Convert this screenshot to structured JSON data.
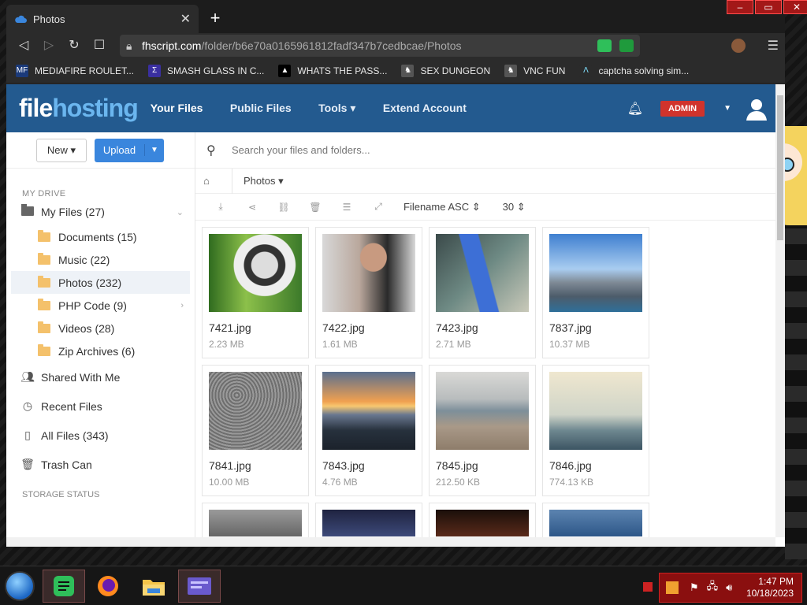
{
  "browser": {
    "tab_title": "Photos",
    "url_host": "fhscript.com",
    "url_path": "/folder/b6e70a0165961812fadf347b7cedbcae/Photos",
    "bookmarks": [
      {
        "label": "MEDIAFIRE ROULET...",
        "icon": "MF"
      },
      {
        "label": "SMASH GLASS IN C...",
        "icon": "Σ"
      },
      {
        "label": "WHATS THE PASS...",
        "icon": "▲"
      },
      {
        "label": "SEX DUNGEON",
        "icon": "♞"
      },
      {
        "label": "VNC FUN",
        "icon": "♞"
      },
      {
        "label": "captcha solving sim...",
        "icon": "Λ"
      }
    ]
  },
  "site": {
    "logo_a": "file",
    "logo_b": "hosting",
    "nav": [
      "Your Files",
      "Public Files",
      "Tools",
      "Extend Account"
    ],
    "admin_badge": "ADMIN"
  },
  "sidebar": {
    "new_label": "New",
    "upload_label": "Upload",
    "my_drive": "MY DRIVE",
    "my_files": "My Files (27)",
    "folders": [
      "Documents (15)",
      "Music (22)",
      "Photos (232)",
      "PHP Code (9)",
      "Videos (28)",
      "Zip Archives (6)"
    ],
    "links": [
      "Shared With Me",
      "Recent Files",
      "All Files (343)",
      "Trash Can"
    ],
    "storage_status": "STORAGE STATUS"
  },
  "main": {
    "search_placeholder": "Search your files and folders...",
    "breadcrumb": "Photos",
    "sort": "Filename ASC",
    "per_page": "30",
    "files": [
      {
        "name": "7421.jpg",
        "size": "2.23 MB"
      },
      {
        "name": "7422.jpg",
        "size": "1.61 MB"
      },
      {
        "name": "7423.jpg",
        "size": "2.71 MB"
      },
      {
        "name": "7837.jpg",
        "size": "10.37 MB"
      },
      {
        "name": "7841.jpg",
        "size": "10.00 MB"
      },
      {
        "name": "7843.jpg",
        "size": "4.76 MB"
      },
      {
        "name": "7845.jpg",
        "size": "212.50 KB"
      },
      {
        "name": "7846.jpg",
        "size": "774.13 KB"
      }
    ]
  },
  "taskbar": {
    "time": "1:47 PM",
    "date": "10/18/2023"
  }
}
